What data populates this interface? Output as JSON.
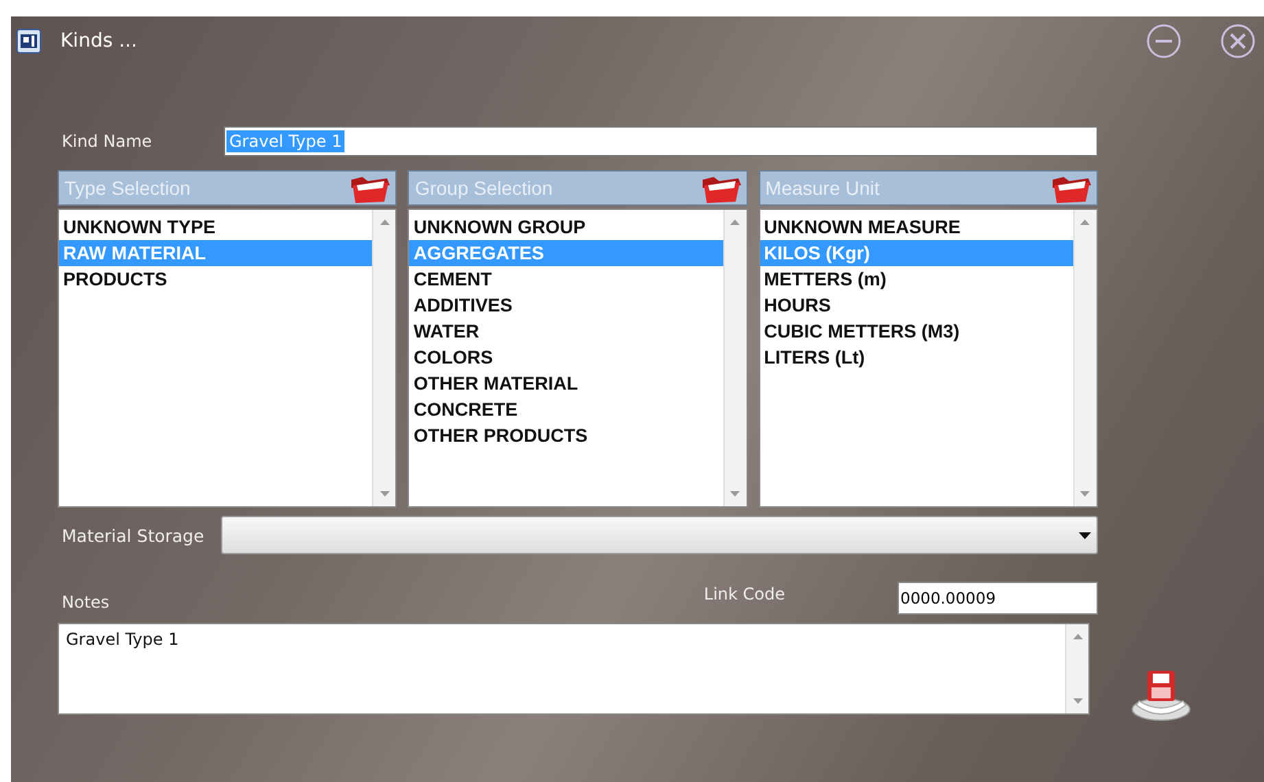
{
  "window": {
    "title": "Kinds ..."
  },
  "kind_name": {
    "label": "Kind Name",
    "value": "Gravel Type 1",
    "highlighted": true
  },
  "lists": [
    {
      "title": "Type Selection",
      "items": [
        {
          "label": "UNKNOWN TYPE",
          "selected": false
        },
        {
          "label": "RAW MATERIAL",
          "selected": true
        },
        {
          "label": "PRODUCTS",
          "selected": false
        }
      ]
    },
    {
      "title": "Group Selection",
      "items": [
        {
          "label": "UNKNOWN GROUP",
          "selected": false
        },
        {
          "label": "AGGREGATES",
          "selected": true
        },
        {
          "label": "CEMENT",
          "selected": false
        },
        {
          "label": "ADDITIVES",
          "selected": false
        },
        {
          "label": "WATER",
          "selected": false
        },
        {
          "label": "COLORS",
          "selected": false
        },
        {
          "label": "OTHER MATERIAL",
          "selected": false
        },
        {
          "label": "CONCRETE",
          "selected": false
        },
        {
          "label": "OTHER PRODUCTS",
          "selected": false
        }
      ]
    },
    {
      "title": "Measure Unit",
      "items": [
        {
          "label": "UNKNOWN MEASURE",
          "selected": false
        },
        {
          "label": "KILOS (Kgr)",
          "selected": true
        },
        {
          "label": "METTERS (m)",
          "selected": false
        },
        {
          "label": "HOURS",
          "selected": false
        },
        {
          "label": "CUBIC METTERS (M3)",
          "selected": false
        },
        {
          "label": "LITERS (Lt)",
          "selected": false
        }
      ]
    }
  ],
  "material_storage": {
    "label": "Material Storage"
  },
  "notes": {
    "label": "Notes",
    "value": "Gravel Type 1"
  },
  "link_code": {
    "label": "Link Code",
    "value": "0000.00009"
  }
}
